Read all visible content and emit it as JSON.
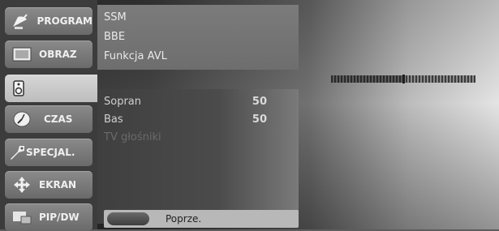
{
  "sidebar": {
    "items": [
      {
        "label": "PROGRAM",
        "icon": "satellite-dish-icon",
        "active": false
      },
      {
        "label": "OBRAZ",
        "icon": "picture-screen-icon",
        "active": false
      },
      {
        "label": "",
        "icon": "speaker-icon",
        "active": true
      },
      {
        "label": "CZAS",
        "icon": "clock-icon",
        "active": false
      },
      {
        "label": "SPECJAL.",
        "icon": "tag-key-icon",
        "active": false
      },
      {
        "label": "EKRAN",
        "icon": "move-arrows-icon",
        "active": false
      },
      {
        "label": "PIP/DW",
        "icon": "pip-screens-icon",
        "active": false
      }
    ]
  },
  "audio_menu": {
    "options": [
      "SSM",
      "BBE",
      "Funkcja AVL"
    ],
    "settings": [
      {
        "label": "Sopran",
        "value": "50"
      },
      {
        "label": "Bas",
        "value": "50"
      },
      {
        "label": "TV głośniki",
        "value": ""
      }
    ]
  },
  "footer": {
    "prev_label": "Poprze."
  },
  "slider": {
    "level_fraction": 0.5
  },
  "colors": {
    "sidebar_bg": "#3c3c3c",
    "item_bg": "#7a7a7a",
    "active_item_bg": "#c9c9c9",
    "footer_bg": "#b8b8b8"
  }
}
